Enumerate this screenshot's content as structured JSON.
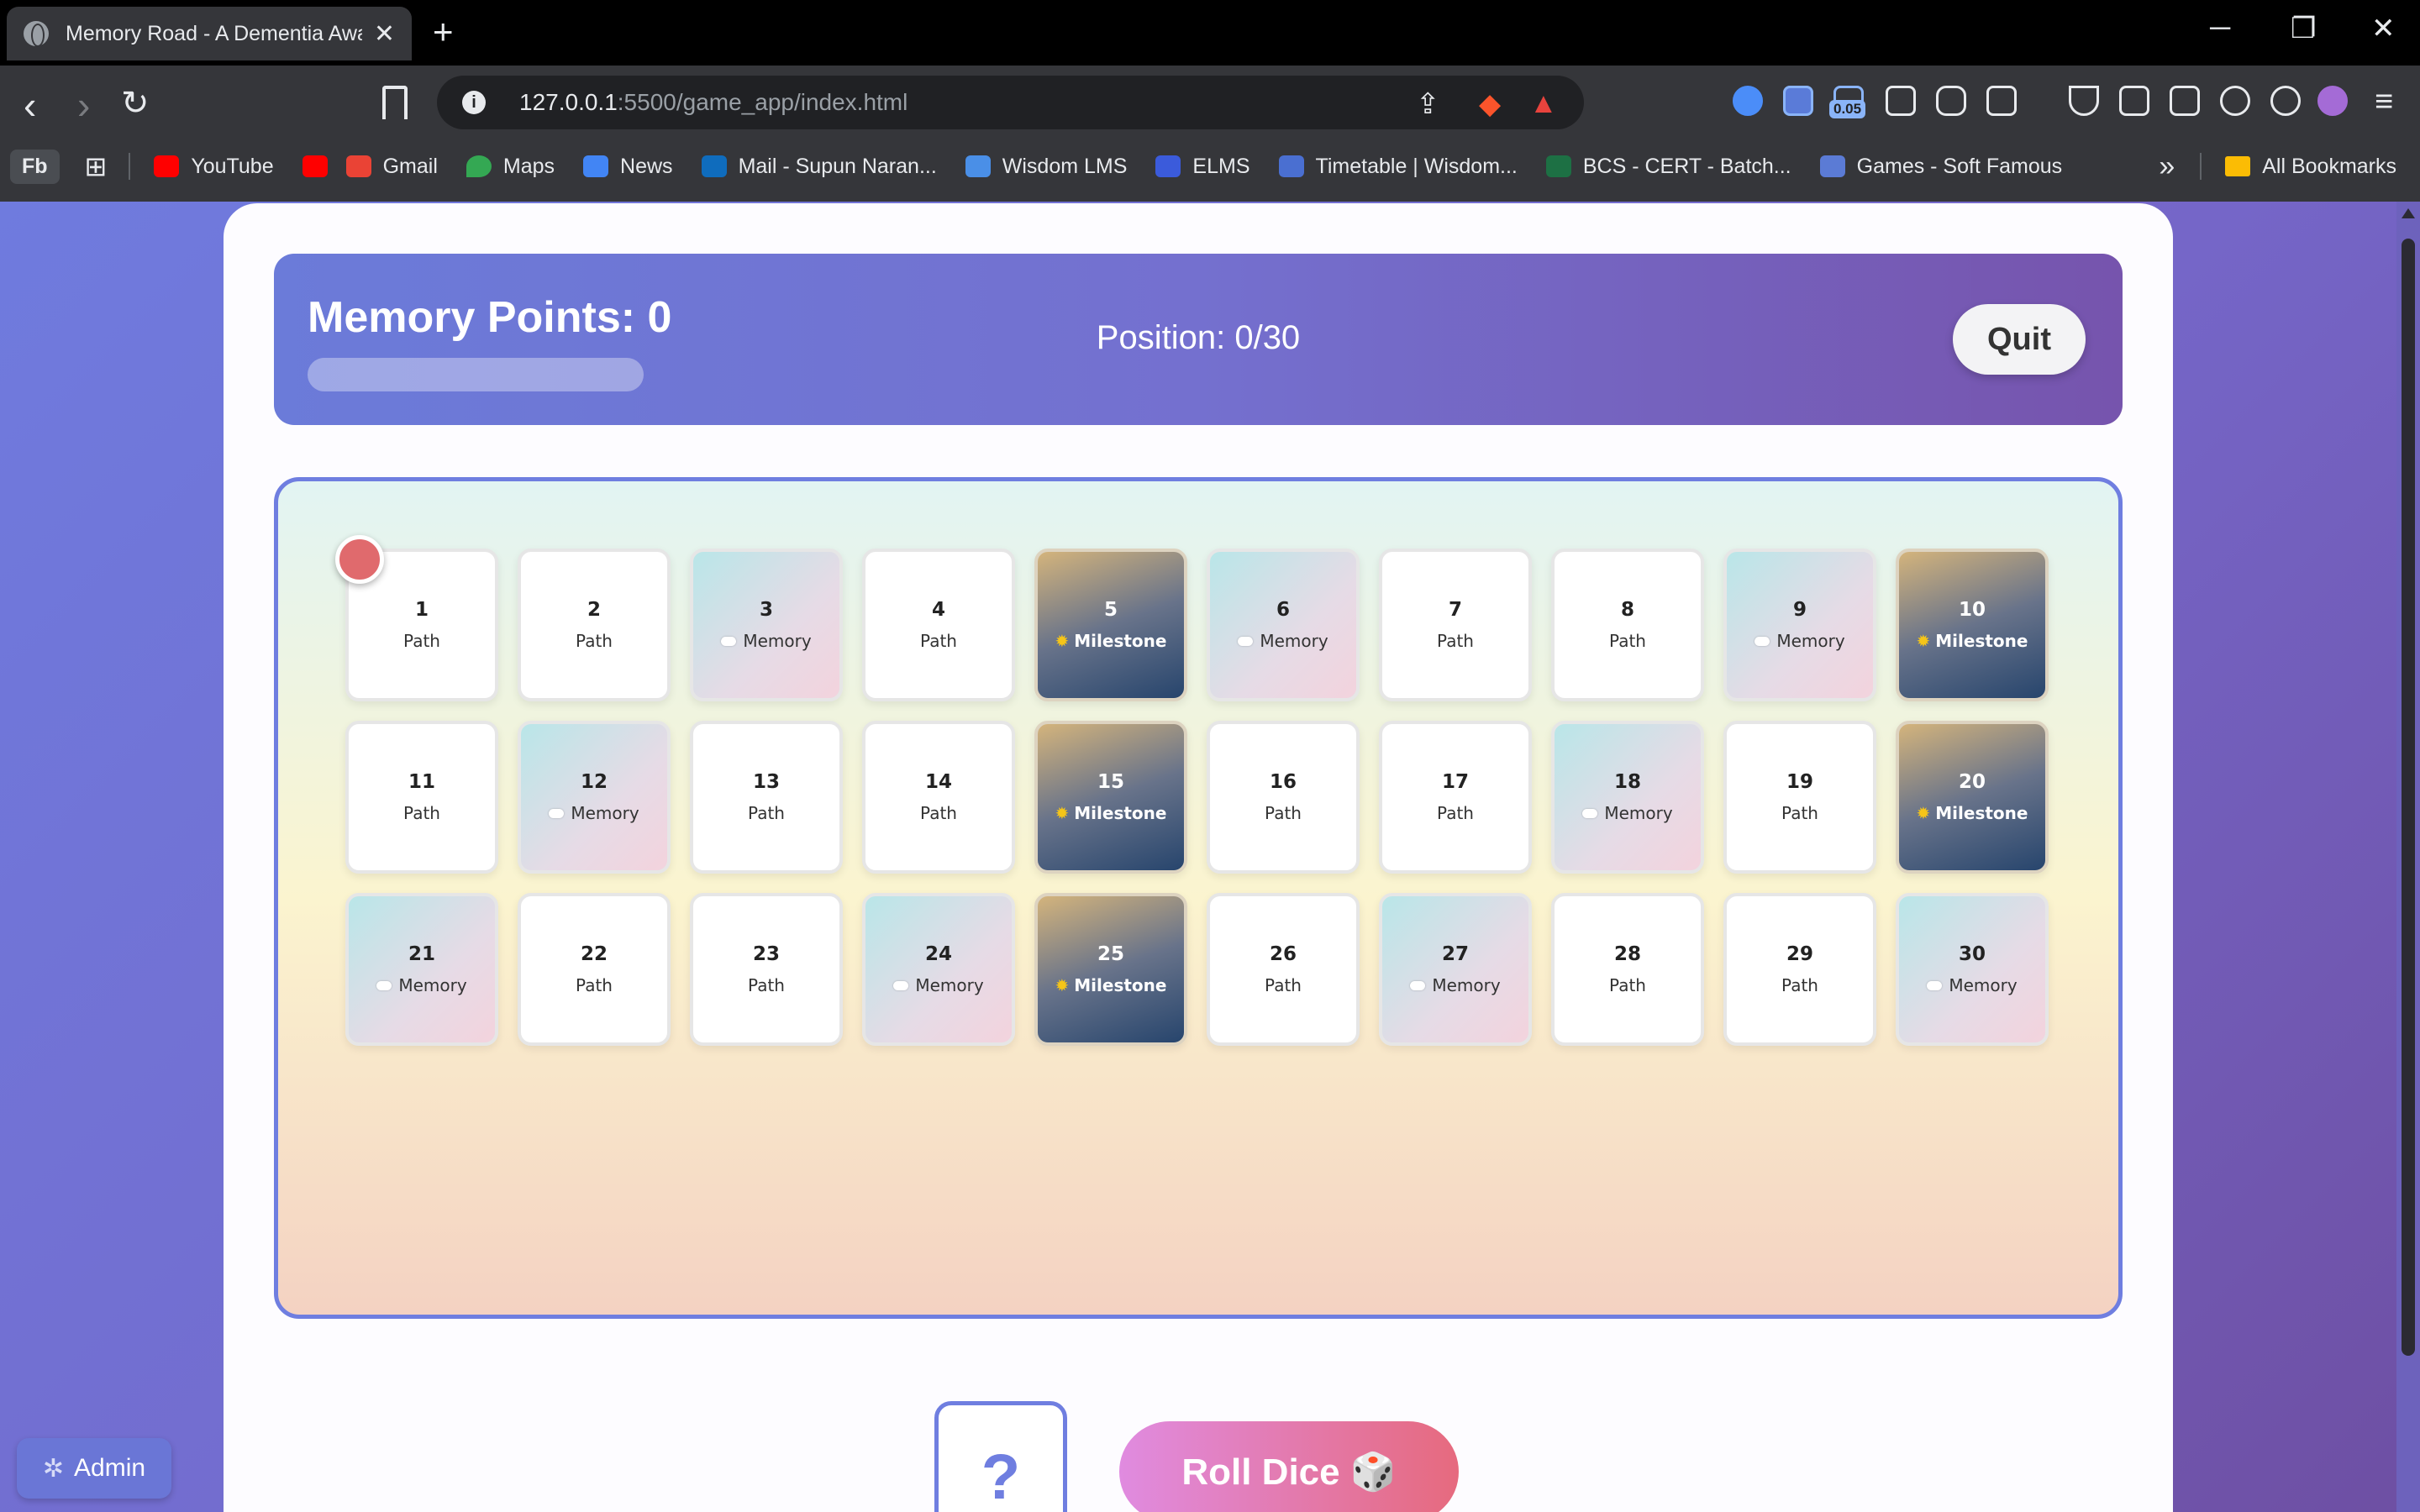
{
  "browser": {
    "tab_title": "Memory Road - A Dementia Awa",
    "tab_close": "✕",
    "new_tab": "+",
    "url_host": "127.0.0.1",
    "url_path": ":5500/game_app/index.html",
    "extension_badge": "0.05",
    "bookmarks": [
      {
        "label": "Fb"
      },
      {
        "label": "YouTube",
        "color": "#ff0000"
      },
      {
        "label": "",
        "color": "#ff0000"
      },
      {
        "label": "Gmail",
        "color": "#ea4335"
      },
      {
        "label": "Maps",
        "color": "#34a853"
      },
      {
        "label": "News",
        "color": "#4285f4"
      },
      {
        "label": "Mail - Supun Naran...",
        "color": "#0f6cbd"
      },
      {
        "label": "Wisdom LMS",
        "color": "#4a8fe7"
      },
      {
        "label": "ELMS",
        "color": "#3b5bdb"
      },
      {
        "label": "Timetable | Wisdom...",
        "color": "#4a6fd1"
      },
      {
        "label": "BCS - CERT - Batch...",
        "color": "#1d7044"
      },
      {
        "label": "Games - Soft Famous",
        "color": "#5b7bd5"
      }
    ],
    "more_bookmarks": "»",
    "all_bookmarks": "All Bookmarks"
  },
  "game": {
    "points_label": "Memory Points: 0",
    "points_progress": 0,
    "position_label": "Position: 0/30",
    "quit_label": "Quit",
    "dice_face": "?",
    "roll_label": "Roll Dice 🎲",
    "admin_label": "Admin",
    "tiles": [
      {
        "n": "1",
        "label": "Path",
        "type": "path"
      },
      {
        "n": "2",
        "label": "Path",
        "type": "path"
      },
      {
        "n": "3",
        "label": "Memory",
        "type": "memory"
      },
      {
        "n": "4",
        "label": "Path",
        "type": "path"
      },
      {
        "n": "5",
        "label": "Milestone",
        "type": "milestone"
      },
      {
        "n": "6",
        "label": "Memory",
        "type": "memory"
      },
      {
        "n": "7",
        "label": "Path",
        "type": "path"
      },
      {
        "n": "8",
        "label": "Path",
        "type": "path"
      },
      {
        "n": "9",
        "label": "Memory",
        "type": "memory"
      },
      {
        "n": "10",
        "label": "Milestone",
        "type": "milestone"
      },
      {
        "n": "11",
        "label": "Path",
        "type": "path"
      },
      {
        "n": "12",
        "label": "Memory",
        "type": "memory"
      },
      {
        "n": "13",
        "label": "Path",
        "type": "path"
      },
      {
        "n": "14",
        "label": "Path",
        "type": "path"
      },
      {
        "n": "15",
        "label": "Milestone",
        "type": "milestone"
      },
      {
        "n": "16",
        "label": "Path",
        "type": "path"
      },
      {
        "n": "17",
        "label": "Path",
        "type": "path"
      },
      {
        "n": "18",
        "label": "Memory",
        "type": "memory"
      },
      {
        "n": "19",
        "label": "Path",
        "type": "path"
      },
      {
        "n": "20",
        "label": "Milestone",
        "type": "milestone"
      },
      {
        "n": "21",
        "label": "Memory",
        "type": "memory"
      },
      {
        "n": "22",
        "label": "Path",
        "type": "path"
      },
      {
        "n": "23",
        "label": "Path",
        "type": "path"
      },
      {
        "n": "24",
        "label": "Memory",
        "type": "memory"
      },
      {
        "n": "25",
        "label": "Milestone",
        "type": "milestone"
      },
      {
        "n": "26",
        "label": "Path",
        "type": "path"
      },
      {
        "n": "27",
        "label": "Memory",
        "type": "memory"
      },
      {
        "n": "28",
        "label": "Path",
        "type": "path"
      },
      {
        "n": "29",
        "label": "Path",
        "type": "path"
      },
      {
        "n": "30",
        "label": "Memory",
        "type": "memory"
      }
    ]
  }
}
